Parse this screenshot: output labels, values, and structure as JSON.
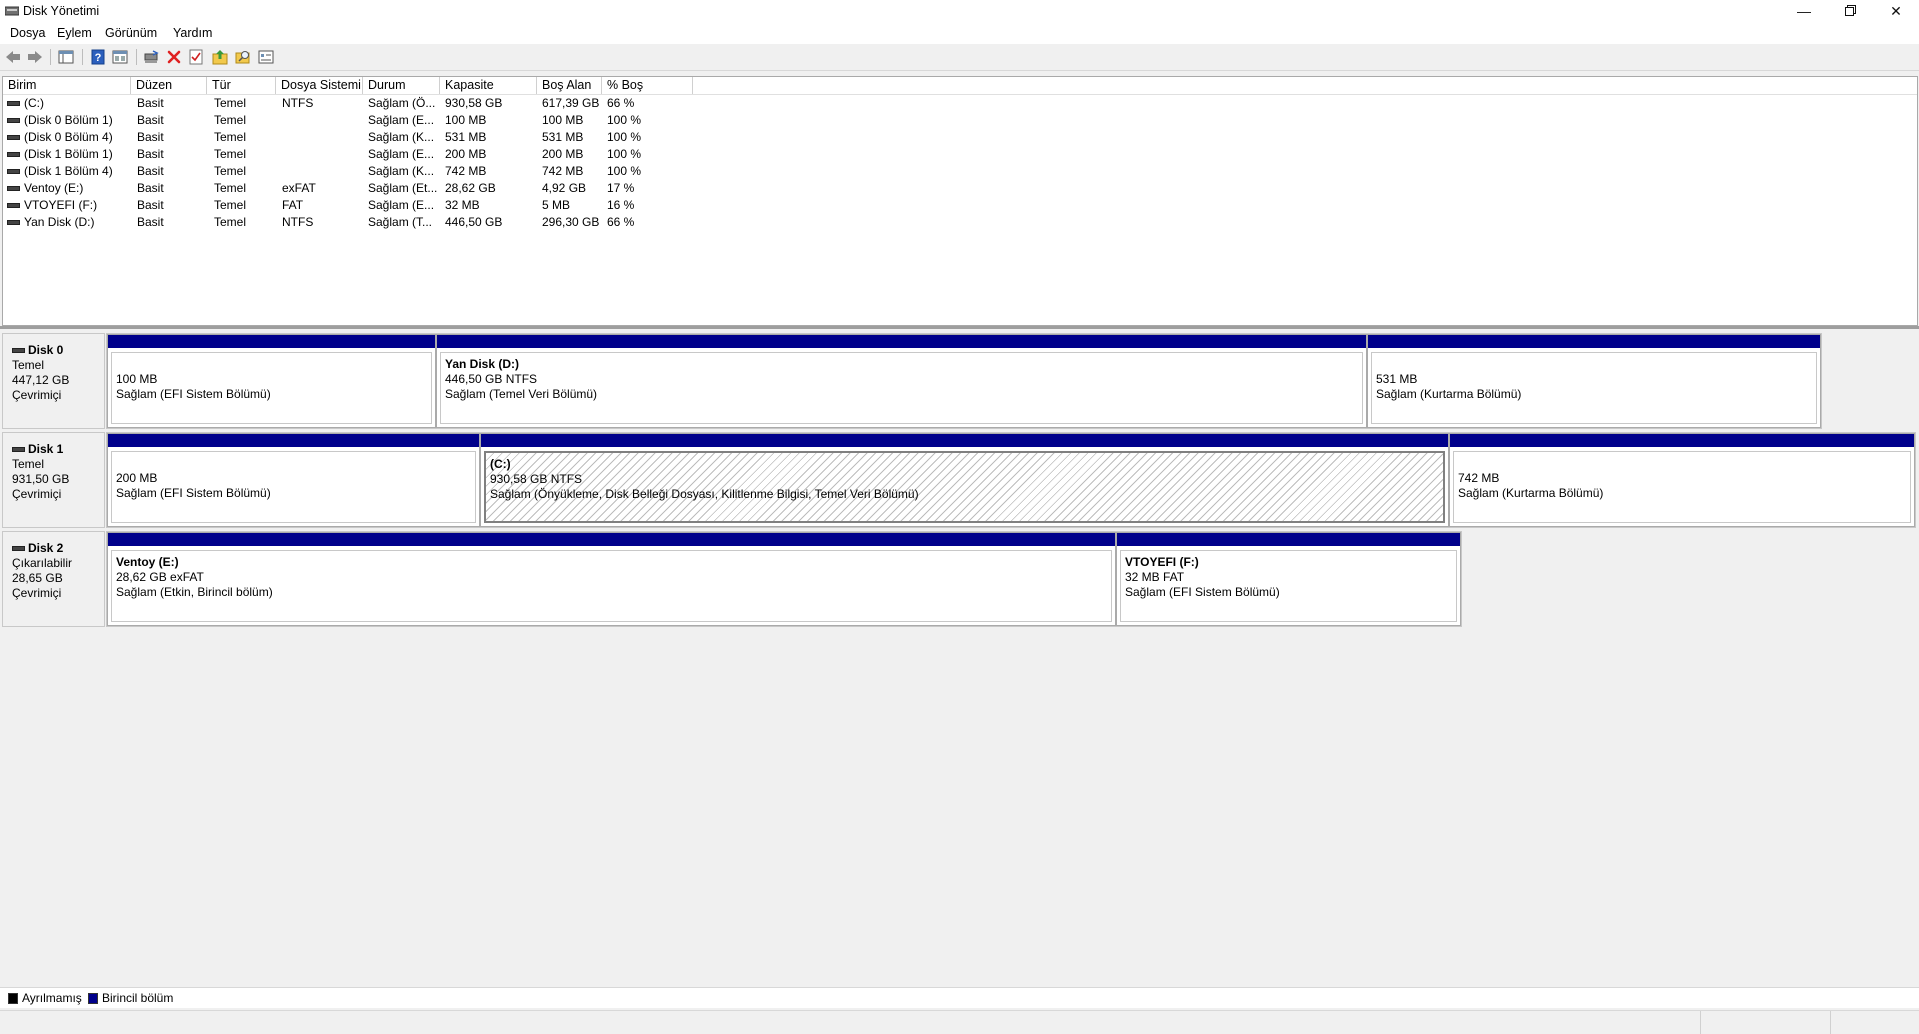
{
  "window": {
    "title": "Disk Yönetimi"
  },
  "menu": [
    "Dosya",
    "Eylem",
    "Görünüm",
    "Yardım"
  ],
  "toolbar": {
    "icons": [
      "back-arrow-icon",
      "forward-arrow-icon",
      "console-tree-icon",
      "help-icon",
      "show-hide-icon",
      "connect-icon",
      "delete-icon",
      "check-icon",
      "up-folder-icon",
      "search-folder-icon",
      "properties-icon"
    ],
    "delete_color": "#e02020"
  },
  "volume_table": {
    "columns": [
      "Birim",
      "Düzen",
      "Tür",
      "Dosya Sistemi",
      "Durum",
      "Kapasite",
      "Boş Alan",
      "% Boş"
    ],
    "rows": [
      [
        "(C:)",
        "Basit",
        "Temel",
        "NTFS",
        "Sağlam (Ö...",
        "930,58 GB",
        "617,39 GB",
        "66 %"
      ],
      [
        "(Disk 0 Bölüm 1)",
        "Basit",
        "Temel",
        "",
        "Sağlam (E...",
        "100 MB",
        "100 MB",
        "100 %"
      ],
      [
        "(Disk 0 Bölüm 4)",
        "Basit",
        "Temel",
        "",
        "Sağlam (K...",
        "531 MB",
        "531 MB",
        "100 %"
      ],
      [
        "(Disk 1 Bölüm 1)",
        "Basit",
        "Temel",
        "",
        "Sağlam (E...",
        "200 MB",
        "200 MB",
        "100 %"
      ],
      [
        "(Disk 1 Bölüm 4)",
        "Basit",
        "Temel",
        "",
        "Sağlam (K...",
        "742 MB",
        "742 MB",
        "100 %"
      ],
      [
        "Ventoy (E:)",
        "Basit",
        "Temel",
        "exFAT",
        "Sağlam (Et...",
        "28,62 GB",
        "4,92 GB",
        "17 %"
      ],
      [
        "VTOYEFI (F:)",
        "Basit",
        "Temel",
        "FAT",
        "Sağlam (E...",
        "32 MB",
        "5 MB",
        "16 %"
      ],
      [
        "Yan Disk (D:)",
        "Basit",
        "Temel",
        "NTFS",
        "Sağlam (T...",
        "446,50 GB",
        "296,30 GB",
        "66 %"
      ]
    ]
  },
  "disks": [
    {
      "name": "Disk 0",
      "type": "Temel",
      "size": "447,12 GB",
      "status": "Çevrimiçi",
      "partitions": [
        {
          "name": "",
          "size": "100 MB",
          "status": "Sağlam (EFI Sistem Bölümü)",
          "hatched": false
        },
        {
          "name": "Yan Disk  (D:)",
          "size": "446,50 GB NTFS",
          "status": "Sağlam (Temel Veri Bölümü)",
          "hatched": false
        },
        {
          "name": "",
          "size": "531 MB",
          "status": "Sağlam (Kurtarma Bölümü)",
          "hatched": false
        }
      ]
    },
    {
      "name": "Disk 1",
      "type": "Temel",
      "size": "931,50 GB",
      "status": "Çevrimiçi",
      "partitions": [
        {
          "name": "",
          "size": "200 MB",
          "status": "Sağlam (EFI Sistem Bölümü)",
          "hatched": false
        },
        {
          "name": "(C:)",
          "size": "930,58 GB NTFS",
          "status": "Sağlam (Önyükleme, Disk Belleği Dosyası, Kilitlenme Bilgisi, Temel Veri Bölümü)",
          "hatched": true
        },
        {
          "name": "",
          "size": "742 MB",
          "status": "Sağlam (Kurtarma Bölümü)",
          "hatched": false
        }
      ]
    },
    {
      "name": "Disk 2",
      "type": "Çıkarılabilir",
      "size": "28,65 GB",
      "status": "Çevrimiçi",
      "partitions": [
        {
          "name": "Ventoy  (E:)",
          "size": "28,62 GB exFAT",
          "status": "Sağlam (Etkin, Birincil bölüm)",
          "hatched": false
        },
        {
          "name": "VTOYEFI  (F:)",
          "size": "32 MB FAT",
          "status": "Sağlam (EFI Sistem Bölümü)",
          "hatched": false
        }
      ]
    }
  ],
  "legend": [
    {
      "label": "Ayrılmamış",
      "color": "#000000"
    },
    {
      "label": "Birincil bölüm",
      "color": "#00008b"
    }
  ]
}
